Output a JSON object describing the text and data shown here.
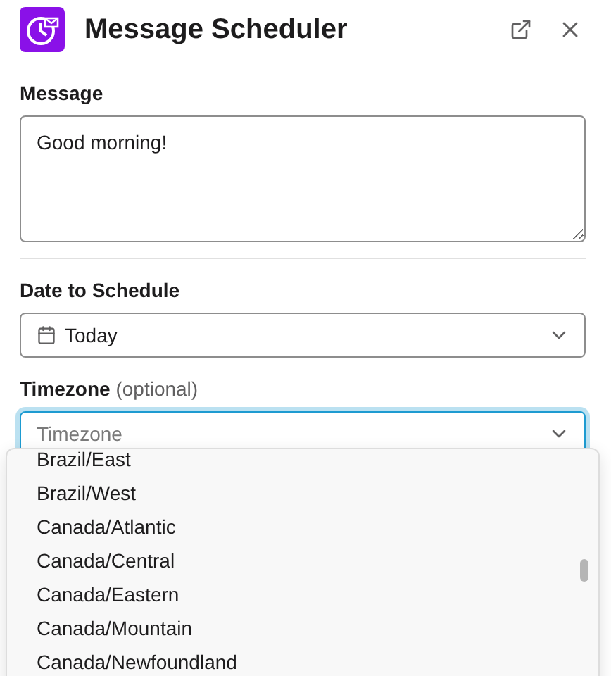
{
  "header": {
    "title": "Message Scheduler"
  },
  "message": {
    "label": "Message",
    "value": "Good morning!"
  },
  "date": {
    "label": "Date to Schedule",
    "value": "Today"
  },
  "timezone": {
    "label": "Timezone",
    "hint": "(optional)",
    "placeholder": "Timezone",
    "focused": true,
    "expanded": true
  },
  "options": [
    {
      "label": "Brazil/East",
      "selected": false
    },
    {
      "label": "Brazil/West",
      "selected": false
    },
    {
      "label": "Canada/Atlantic",
      "selected": false
    },
    {
      "label": "Canada/Central",
      "selected": false
    },
    {
      "label": "Canada/Eastern",
      "selected": false
    },
    {
      "label": "Canada/Mountain",
      "selected": false
    },
    {
      "label": "Canada/Newfoundland",
      "selected": false
    }
  ]
}
